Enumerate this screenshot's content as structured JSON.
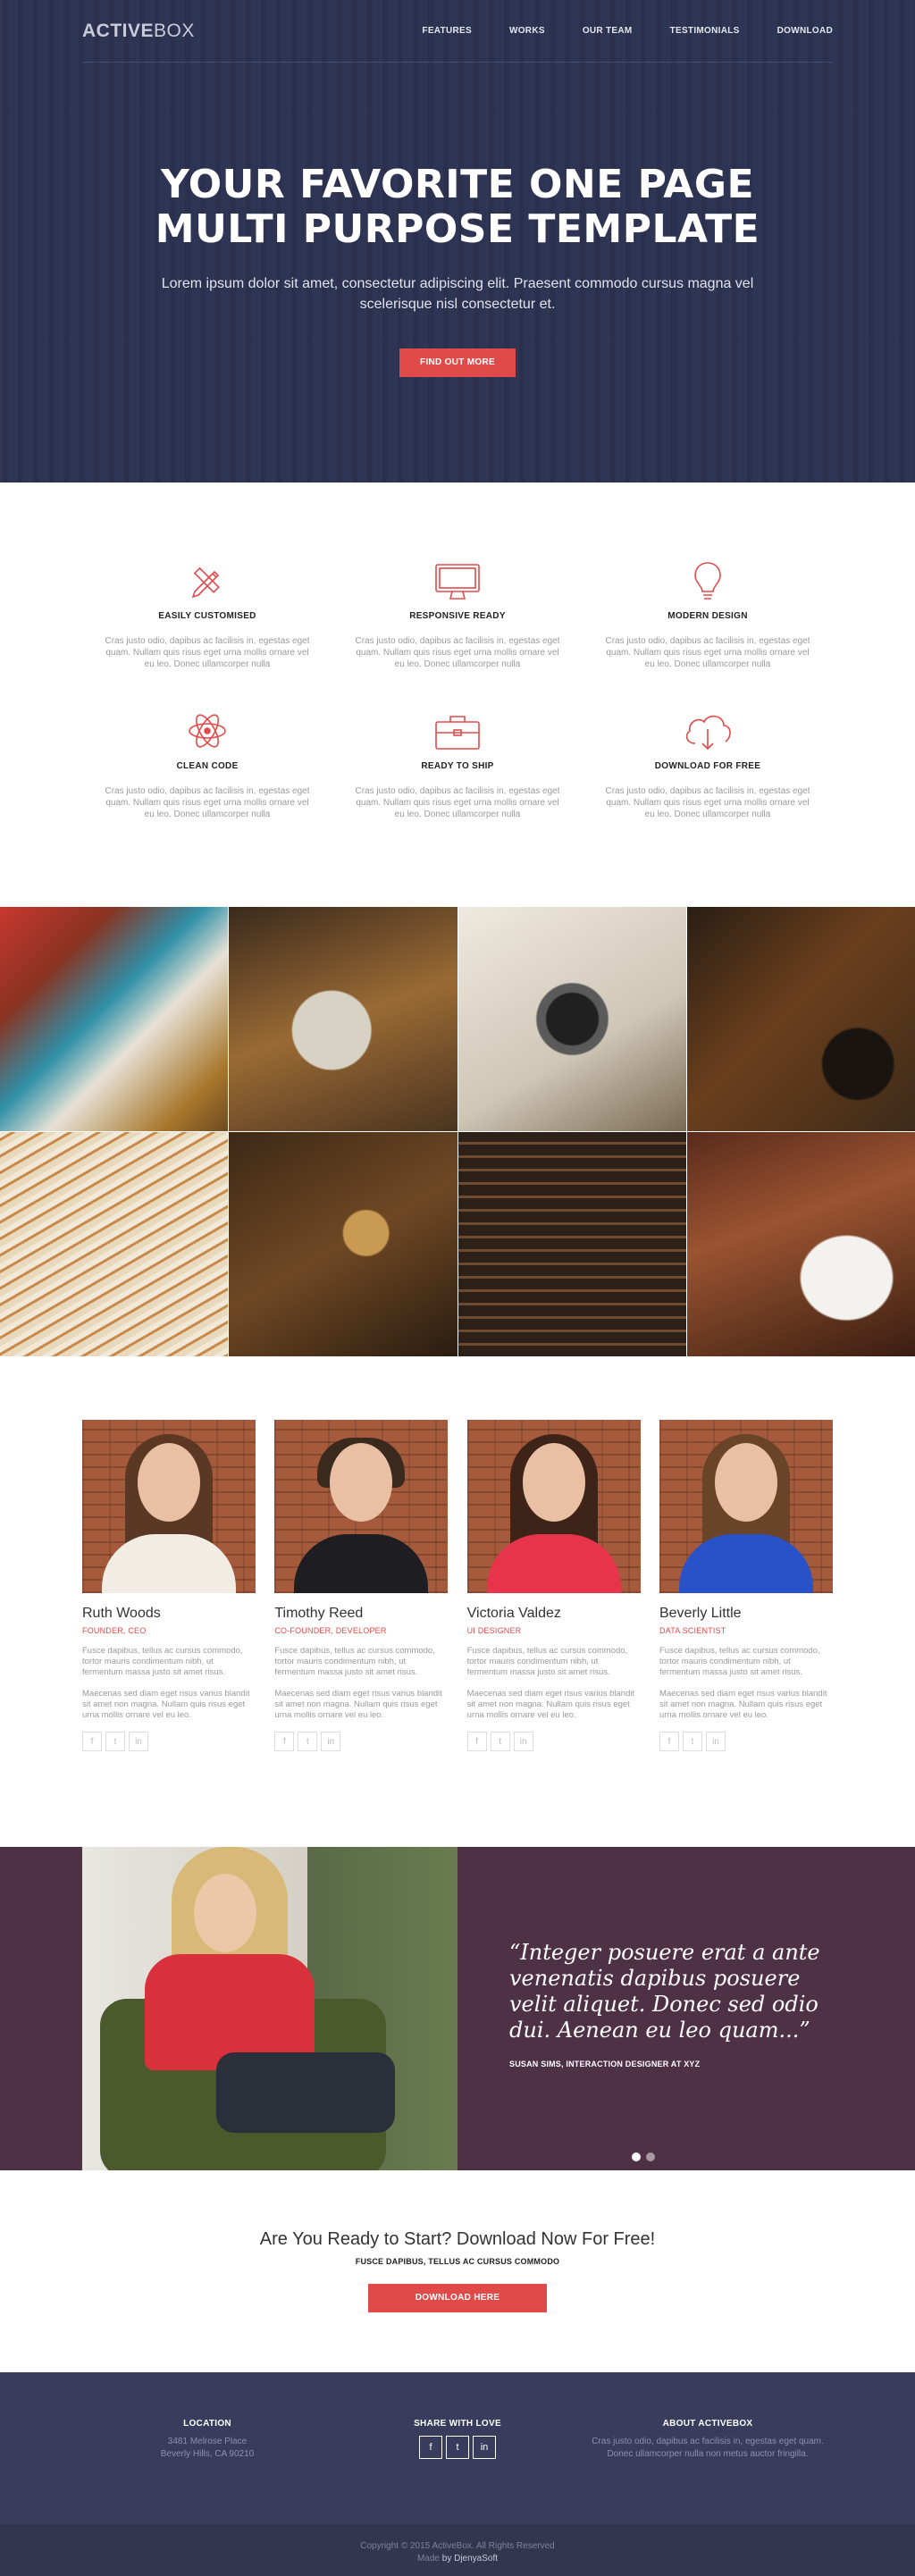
{
  "brand": {
    "bold": "ACTIVE",
    "light": "BOX"
  },
  "nav": {
    "items": [
      "FEATURES",
      "WORKS",
      "OUR TEAM",
      "TESTIMONIALS",
      "DOWNLOAD"
    ]
  },
  "hero": {
    "title_line1": "YOUR FAVORITE ONE PAGE",
    "title_line2": "MULTI PURPOSE TEMPLATE",
    "subtitle": "Lorem ipsum dolor sit amet, consectetur adipiscing elit. Praesent commodo cursus magna vel scelerisque nisl consectetur et.",
    "button": "FIND OUT MORE"
  },
  "features": [
    {
      "icon": "pencil-ruler-icon",
      "title": "EASILY CUSTOMISED",
      "text": "Cras justo odio, dapibus ac facilisis in, egestas eget quam. Nullam quis risus eget urna mollis ornare vel eu leo. Donec ullamcorper nulla"
    },
    {
      "icon": "monitor-icon",
      "title": "RESPONSIVE READY",
      "text": "Cras justo odio, dapibus ac facilisis in, egestas eget quam. Nullam quis risus eget urna mollis ornare vel eu leo. Donec ullamcorper nulla"
    },
    {
      "icon": "lightbulb-icon",
      "title": "MODERN DESIGN",
      "text": "Cras justo odio, dapibus ac facilisis in, egestas eget quam. Nullam quis risus eget urna mollis ornare vel eu leo. Donec ullamcorper nulla"
    },
    {
      "icon": "atom-icon",
      "title": "CLEAN CODE",
      "text": "Cras justo odio, dapibus ac facilisis in, egestas eget quam. Nullam quis risus eget urna mollis ornare vel eu leo. Donec ullamcorper nulla"
    },
    {
      "icon": "briefcase-icon",
      "title": "READY TO SHIP",
      "text": "Cras justo odio, dapibus ac facilisis in, egestas eget quam. Nullam quis risus eget urna mollis ornare vel eu leo. Donec ullamcorper nulla"
    },
    {
      "icon": "cloud-download-icon",
      "title": "DOWNLOAD FOR FREE",
      "text": "Cras justo odio, dapibus ac facilisis in, egestas eget quam. Nullam quis risus eget urna mollis ornare vel eu leo. Donec ullamcorper nulla"
    }
  ],
  "team": [
    {
      "name": "Ruth Woods",
      "role": "FOUNDER, CEO",
      "p1": "Fusce dapibus, tellus ac cursus commodo, tortor mauris condimentum nibh, ut fermentum massa justo sit amet risus.",
      "p2": "Maecenas sed diam eget risus varius blandit sit amet non magna. Nullam quis risus eget urna mollis ornare vel eu leo."
    },
    {
      "name": "Timothy Reed",
      "role": "CO-FOUNDER, DEVELOPER",
      "p1": "Fusce dapibus, tellus ac cursus commodo, tortor mauris condimentum nibh, ut fermentum massa justo sit amet risus.",
      "p2": "Maecenas sed diam eget risus varius blandit sit amet non magna. Nullam quis risus eget urna mollis ornare vel eu leo."
    },
    {
      "name": "Victoria Valdez",
      "role": "UI DESIGNER",
      "p1": "Fusce dapibus, tellus ac cursus commodo, tortor mauris condimentum nibh, ut fermentum massa justo sit amet risus.",
      "p2": "Maecenas sed diam eget risus varius blandit sit amet non magna. Nullam quis risus eget urna mollis ornare vel eu leo."
    },
    {
      "name": "Beverly Little",
      "role": "DATA SCIENTIST",
      "p1": "Fusce dapibus, tellus ac cursus commodo, tortor mauris condimentum nibh, ut fermentum massa justo sit amet risus.",
      "p2": "Maecenas sed diam eget risus varius blandit sit amet non magna. Nullam quis risus eget urna mollis ornare vel eu leo."
    }
  ],
  "testimonial": {
    "quote": "“Integer posuere erat a ante venenatis dapibus posuere velit aliquet. Donec sed odio dui. Aenean eu leo quam...”",
    "author": "SUSAN SIMS, INTERACTION DESIGNER AT XYZ"
  },
  "cta": {
    "title": "Are You Ready to Start? Download Now For Free!",
    "subtitle": "FUSCE DAPIBUS, TELLUS AC CURSUS COMMODO",
    "button": "DOWNLOAD HERE"
  },
  "footer": {
    "location_title": "LOCATION",
    "address1": "3481 Melrose Place",
    "address2": "Beverly Hills, CA 90210",
    "share_title": "SHARE WITH LOVE",
    "about_title": "ABOUT ACTIVEBOX",
    "about_text": "Cras justo odio, dapibus ac facilisis in, egestas eget quam. Donec ullamcorper nulla non metus auctor fringilla.",
    "copyright": "Copyright © 2015 ActiveBox. All Rights Reserved",
    "made_prefix": "Made ",
    "made_by": "by DjenyaSoft"
  },
  "colors": {
    "accent": "#e04b4a",
    "hero_bg": "#2b3150",
    "testimonial_bg": "#4e3145",
    "footer_bg": "#3a3c5e"
  }
}
